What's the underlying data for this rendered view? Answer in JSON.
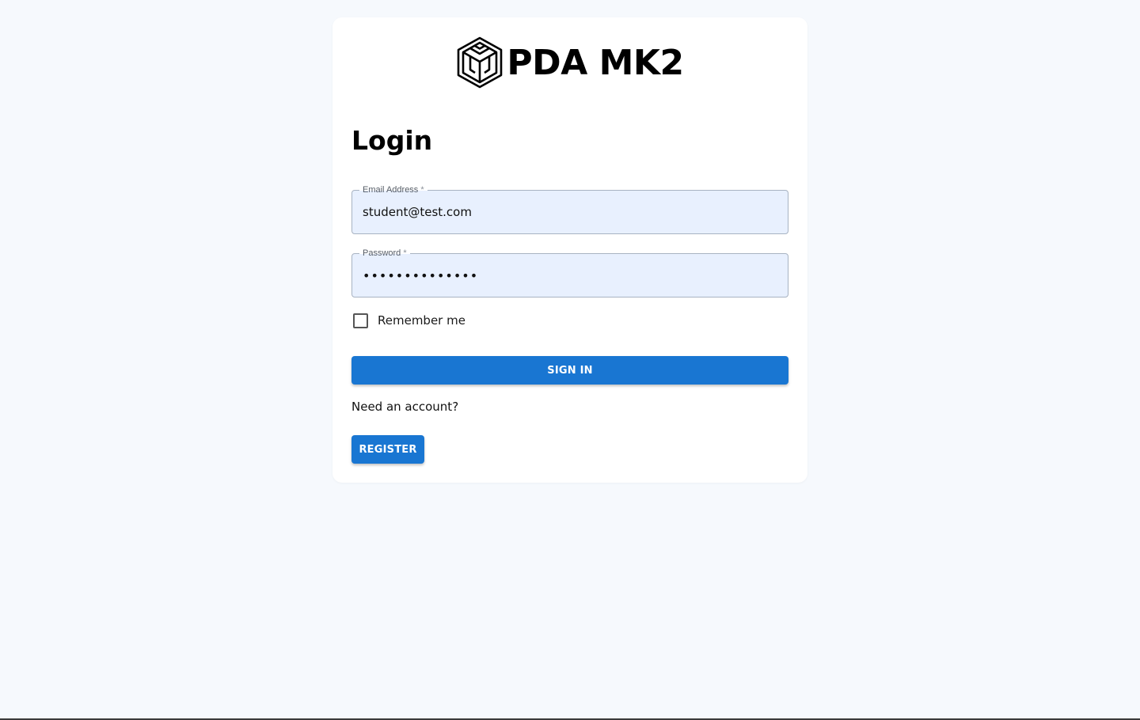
{
  "brand": {
    "name": "PDA MK2",
    "logo_icon": "hexagon-cube-icon"
  },
  "login": {
    "title": "Login",
    "email": {
      "label": "Email Address",
      "required_marker": "*",
      "value": "student@test.com"
    },
    "password": {
      "label": "Password",
      "required_marker": "*",
      "value": "••••••••••••••"
    },
    "remember": {
      "label": "Remember me",
      "checked": false
    },
    "sign_in_label": "SIGN IN",
    "need_account_text": "Need an account?",
    "register_label": "REGISTER"
  },
  "colors": {
    "background": "#f6f9fd",
    "card": "#ffffff",
    "primary": "#1976d2",
    "field_fill": "#e8f0fe"
  }
}
